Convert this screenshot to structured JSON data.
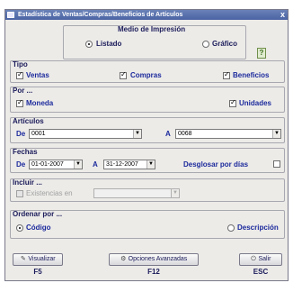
{
  "window": {
    "title": "Estadística de Ventas/Compras/Beneficios de Artículos",
    "close": "x"
  },
  "medio": {
    "label": "Medio de Impresión",
    "options": [
      "Listado",
      "Gráfico"
    ],
    "selected": "Listado"
  },
  "tipo": {
    "label": "Tipo",
    "ventas": "Ventas",
    "compras": "Compras",
    "beneficios": "Beneficios"
  },
  "por": {
    "label": "Por ...",
    "moneda": "Moneda",
    "unidades": "Unidades"
  },
  "articulos": {
    "label": "Artículos",
    "de_label": "De",
    "de_value": "0001",
    "a_label": "A",
    "a_value": "0068"
  },
  "fechas": {
    "label": "Fechas",
    "de_label": "De",
    "de_value": "01-01-2007",
    "a_label": "A",
    "a_value": "31-12-2007",
    "desglosar": "Desglosar por días"
  },
  "incluir": {
    "label": "Incluir ...",
    "existencias": "Existencias en",
    "existencias_value": ""
  },
  "ordenar": {
    "label": "Ordenar por ...",
    "codigo": "Código",
    "descripcion": "Descripción",
    "selected": "Código"
  },
  "buttons": {
    "visualizar": {
      "label": "Visualizar",
      "key": "F5"
    },
    "opciones": {
      "label": "Opciones Avanzadas",
      "key": "F12"
    },
    "salir": {
      "label": "Salir",
      "key": "ESC"
    }
  },
  "icons": {
    "help": "?",
    "combo_arrow": "▼"
  }
}
